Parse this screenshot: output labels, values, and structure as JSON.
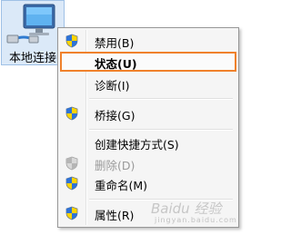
{
  "desktop_icon": {
    "label": "本地连接"
  },
  "context_menu": {
    "items": [
      {
        "label": "禁用(B)",
        "icon": "uac-shield-icon",
        "bold": false,
        "disabled": false
      },
      {
        "label": "状态(U)",
        "icon": null,
        "bold": true,
        "disabled": false,
        "highlighted": true
      },
      {
        "label": "诊断(I)",
        "icon": null,
        "bold": false,
        "disabled": false
      },
      {
        "label": "桥接(G)",
        "icon": "uac-shield-icon",
        "bold": false,
        "disabled": false
      },
      {
        "label": "创建快捷方式(S)",
        "icon": null,
        "bold": false,
        "disabled": false
      },
      {
        "label": "删除(D)",
        "icon": "uac-shield-icon",
        "bold": false,
        "disabled": true
      },
      {
        "label": "重命名(M)",
        "icon": "uac-shield-icon",
        "bold": false,
        "disabled": false
      },
      {
        "label": "属性(R)",
        "icon": "uac-shield-icon",
        "bold": false,
        "disabled": false
      }
    ]
  },
  "watermark": {
    "text": "Baidu 经验",
    "sub": "jingyan.baidu.com"
  },
  "colors": {
    "highlight_border": "#f0812b",
    "menu_bg": "#f5f5f5"
  }
}
